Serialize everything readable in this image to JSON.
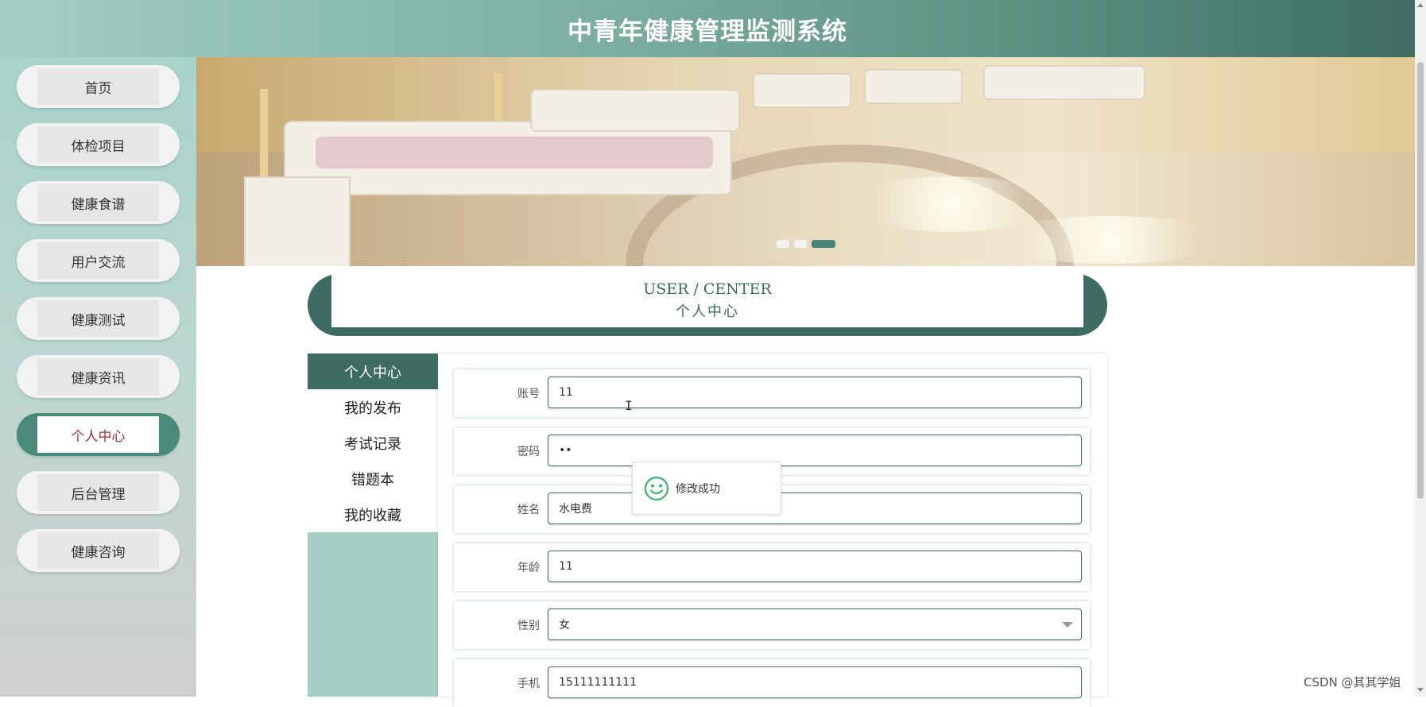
{
  "header": {
    "title": "中青年健康管理监测系统"
  },
  "sidebar": {
    "items": [
      {
        "label": "首页",
        "active": false
      },
      {
        "label": "体检项目",
        "active": false
      },
      {
        "label": "健康食谱",
        "active": false
      },
      {
        "label": "用户交流",
        "active": false
      },
      {
        "label": "健康测试",
        "active": false
      },
      {
        "label": "健康资讯",
        "active": false
      },
      {
        "label": "个人中心",
        "active": true
      },
      {
        "label": "后台管理",
        "active": false
      },
      {
        "label": "健康咨询",
        "active": false
      }
    ]
  },
  "banner": {
    "slide_count": 3,
    "active_slide": 3
  },
  "section": {
    "title_en": "USER / CENTER",
    "title_cn": "个人中心"
  },
  "left_menu": {
    "items": [
      {
        "label": "个人中心",
        "active": true
      },
      {
        "label": "我的发布",
        "active": false
      },
      {
        "label": "考试记录",
        "active": false
      },
      {
        "label": "错题本",
        "active": false
      },
      {
        "label": "我的收藏",
        "active": false
      }
    ]
  },
  "form": {
    "account": {
      "label": "账号",
      "value": "11"
    },
    "password": {
      "label": "密码",
      "value": "••"
    },
    "name": {
      "label": "姓名",
      "value": "水电费"
    },
    "age": {
      "label": "年龄",
      "value": "11"
    },
    "gender": {
      "label": "性别",
      "value": "女"
    },
    "phone": {
      "label": "手机",
      "value": "15111111111"
    }
  },
  "toast": {
    "message": "修改成功",
    "icon": "smile-icon"
  },
  "watermark": {
    "text": "CSDN @其其学姐"
  },
  "colors": {
    "primary": "#3e6b62",
    "accent": "#a3313b",
    "sidebar": "#a8d3c9"
  }
}
